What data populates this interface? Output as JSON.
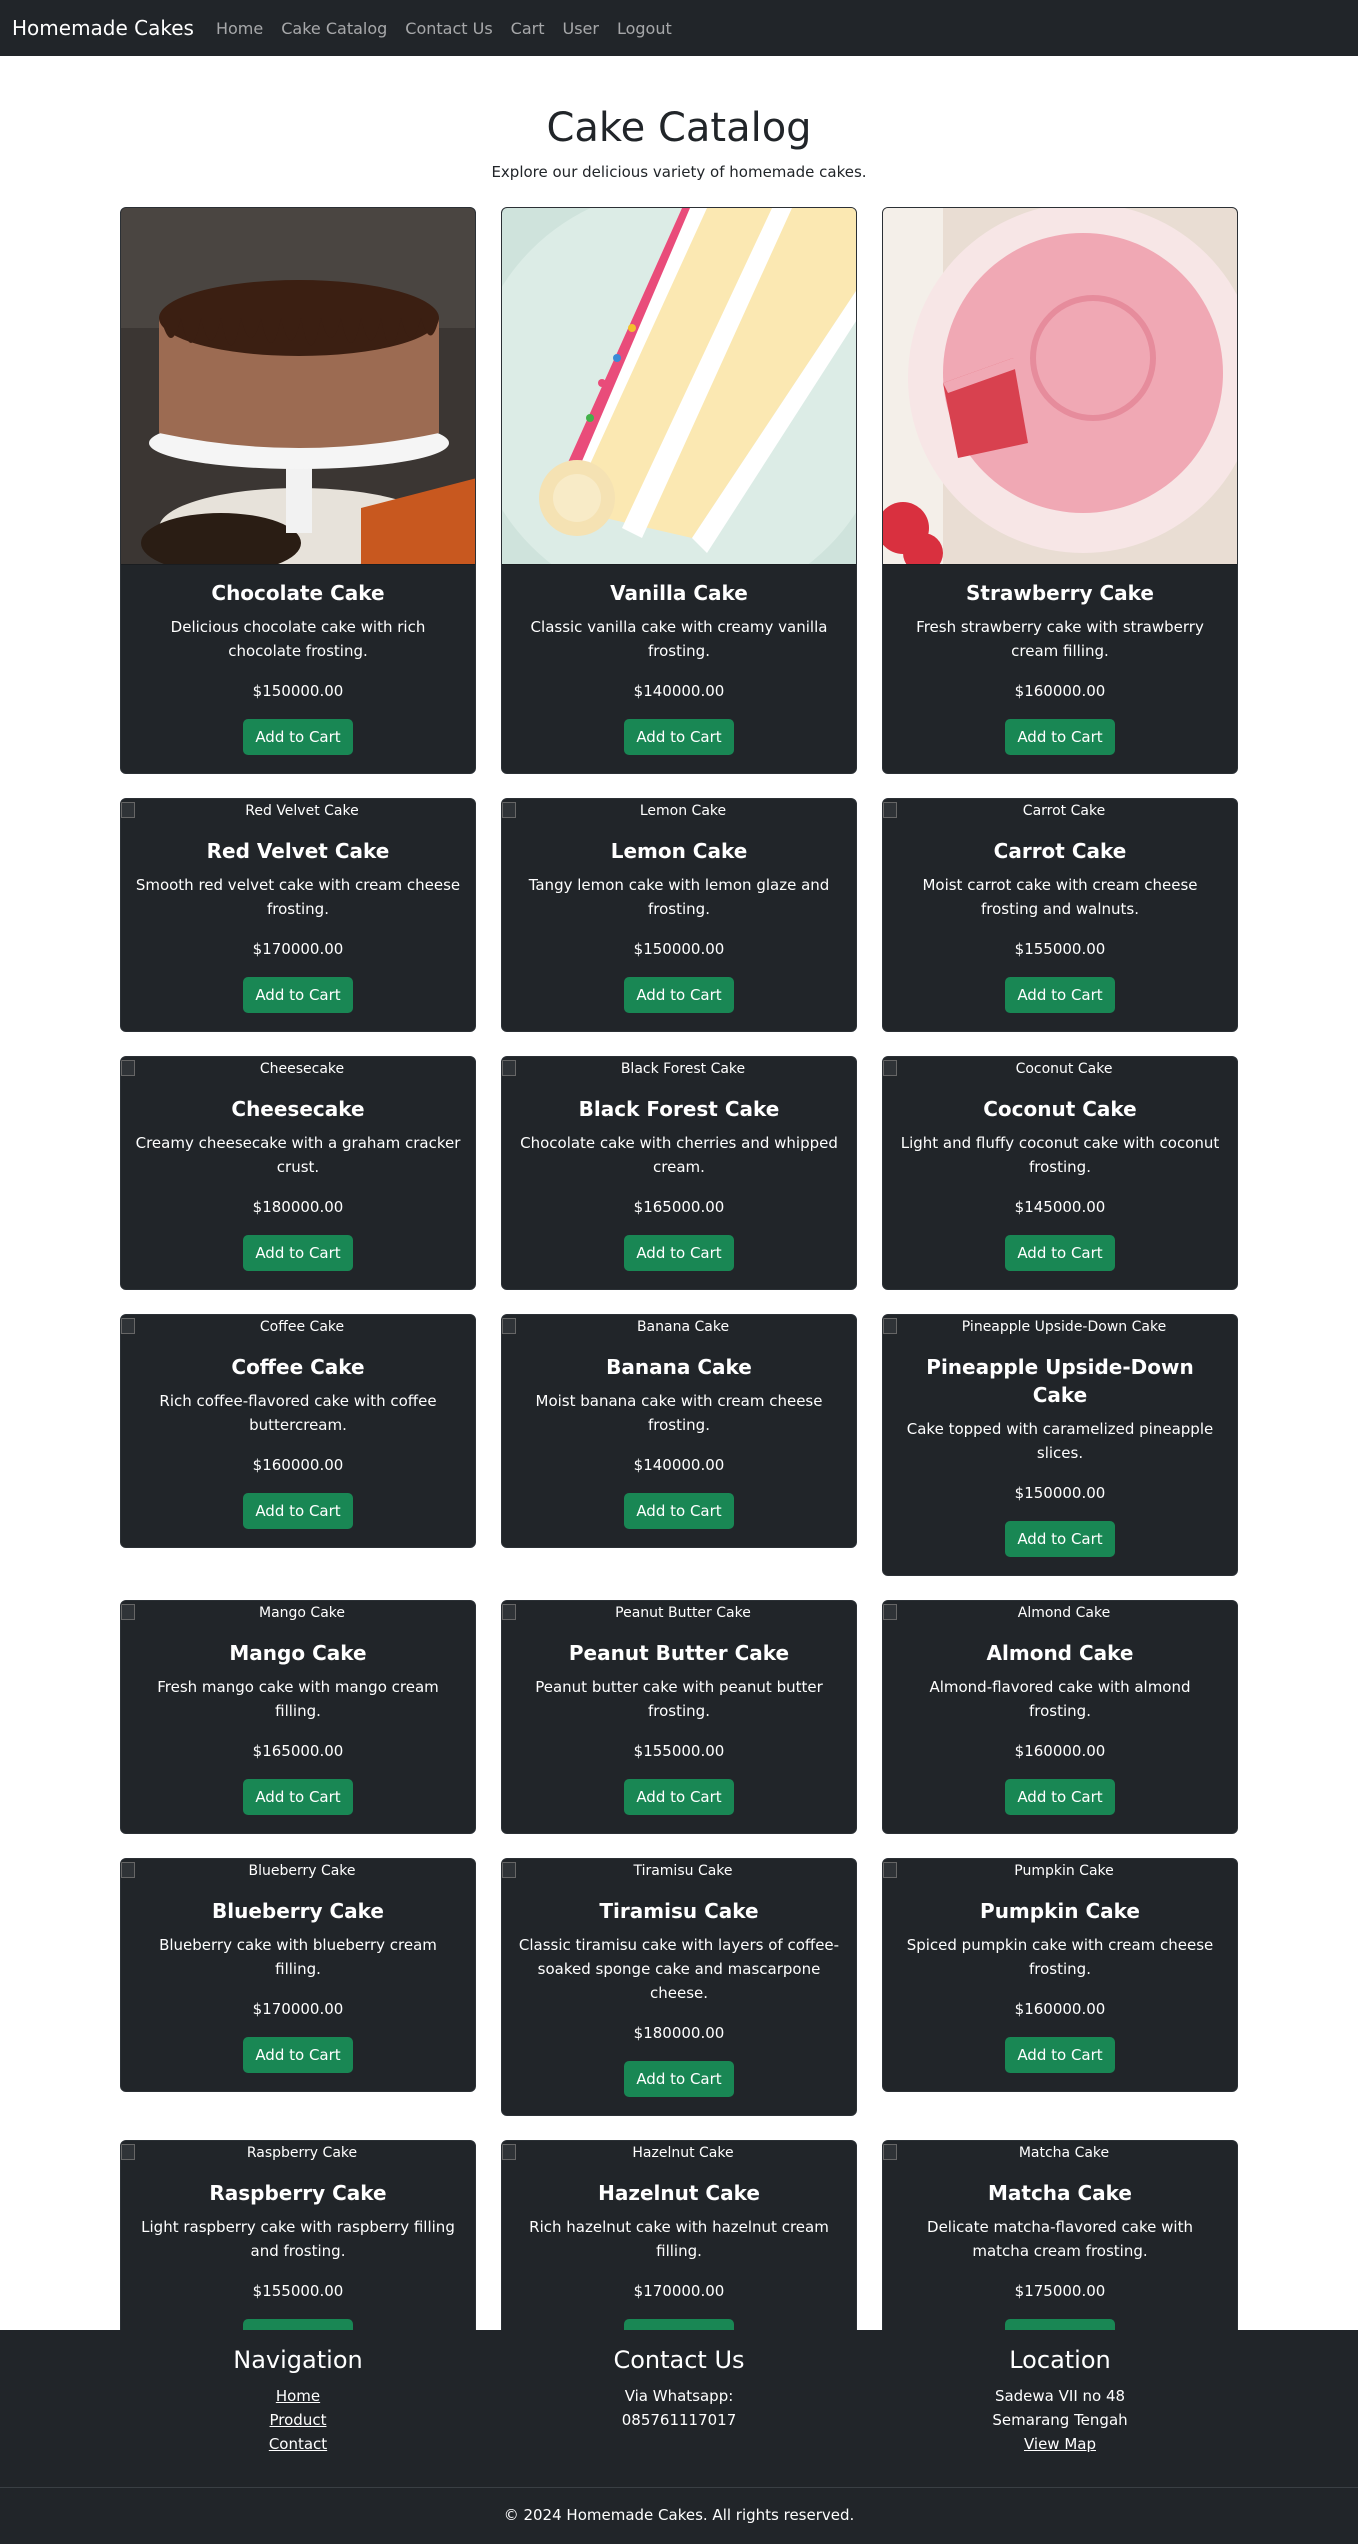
{
  "navbar": {
    "brand": "Homemade Cakes",
    "links": [
      "Home",
      "Cake Catalog",
      "Contact Us",
      "Cart",
      "User",
      "Logout"
    ]
  },
  "header": {
    "title": "Cake Catalog",
    "subtitle": "Explore our delicious variety of homemade cakes."
  },
  "cart_button_label": "Add to Cart",
  "cakes": [
    {
      "name": "Chocolate Cake",
      "description": "Delicious chocolate cake with rich chocolate frosting.",
      "price": "$150000.00",
      "image": "chocolate-cake-photo"
    },
    {
      "name": "Vanilla Cake",
      "description": "Classic vanilla cake with creamy vanilla frosting.",
      "price": "$140000.00",
      "image": "vanilla-cake-photo"
    },
    {
      "name": "Strawberry Cake",
      "description": "Fresh strawberry cake with strawberry cream filling.",
      "price": "$160000.00",
      "image": "strawberry-cake-photo"
    },
    {
      "name": "Red Velvet Cake",
      "alt": "Red Velvet Cake",
      "description": "Smooth red velvet cake with cream cheese frosting.",
      "price": "$170000.00"
    },
    {
      "name": "Lemon Cake",
      "alt": "Lemon Cake",
      "description": "Tangy lemon cake with lemon glaze and frosting.",
      "price": "$150000.00"
    },
    {
      "name": "Carrot Cake",
      "alt": "Carrot Cake",
      "description": "Moist carrot cake with cream cheese frosting and walnuts.",
      "price": "$155000.00"
    },
    {
      "name": "Cheesecake",
      "alt": "Cheesecake",
      "description": "Creamy cheesecake with a graham cracker crust.",
      "price": "$180000.00"
    },
    {
      "name": "Black Forest Cake",
      "alt": "Black Forest Cake",
      "description": "Chocolate cake with cherries and whipped cream.",
      "price": "$165000.00"
    },
    {
      "name": "Coconut Cake",
      "alt": "Coconut Cake",
      "description": "Light and fluffy coconut cake with coconut frosting.",
      "price": "$145000.00"
    },
    {
      "name": "Coffee Cake",
      "alt": "Coffee Cake",
      "description": "Rich coffee-flavored cake with coffee buttercream.",
      "price": "$160000.00"
    },
    {
      "name": "Banana Cake",
      "alt": "Banana Cake",
      "description": "Moist banana cake with cream cheese frosting.",
      "price": "$140000.00"
    },
    {
      "name": "Pineapple Upside-Down Cake",
      "alt": "Pineapple Upside-Down Cake",
      "description": "Cake topped with caramelized pineapple slices.",
      "price": "$150000.00"
    },
    {
      "name": "Mango Cake",
      "alt": "Mango Cake",
      "description": "Fresh mango cake with mango cream filling.",
      "price": "$165000.00"
    },
    {
      "name": "Peanut Butter Cake",
      "alt": "Peanut Butter Cake",
      "description": "Peanut butter cake with peanut butter frosting.",
      "price": "$155000.00"
    },
    {
      "name": "Almond Cake",
      "alt": "Almond Cake",
      "description": "Almond-flavored cake with almond frosting.",
      "price": "$160000.00"
    },
    {
      "name": "Blueberry Cake",
      "alt": "Blueberry Cake",
      "description": "Blueberry cake with blueberry cream filling.",
      "price": "$170000.00"
    },
    {
      "name": "Tiramisu Cake",
      "alt": "Tiramisu Cake",
      "description": "Classic tiramisu cake with layers of coffee-soaked sponge cake and mascarpone cheese.",
      "price": "$180000.00"
    },
    {
      "name": "Pumpkin Cake",
      "alt": "Pumpkin Cake",
      "description": "Spiced pumpkin cake with cream cheese frosting.",
      "price": "$160000.00"
    },
    {
      "name": "Raspberry Cake",
      "alt": "Raspberry Cake",
      "description": "Light raspberry cake with raspberry filling and frosting.",
      "price": "$155000.00"
    },
    {
      "name": "Hazelnut Cake",
      "alt": "Hazelnut Cake",
      "description": "Rich hazelnut cake with hazelnut cream filling.",
      "price": "$170000.00"
    },
    {
      "name": "Matcha Cake",
      "alt": "Matcha Cake",
      "description": "Delicate matcha-flavored cake with matcha cream frosting.",
      "price": "$175000.00"
    }
  ],
  "footer": {
    "navigation": {
      "title": "Navigation",
      "links": [
        "Home",
        "Product",
        "Contact"
      ]
    },
    "contact": {
      "title": "Contact Us",
      "lines": [
        "Via Whatsapp:",
        "085761117017"
      ]
    },
    "location": {
      "title": "Location",
      "lines": [
        "Sadewa VII no 48",
        "Semarang Tengah"
      ],
      "map_link": "View Map"
    },
    "copyright": "© 2024 Homemade Cakes. All rights reserved."
  },
  "colors": {
    "dark": "#212529",
    "button_green": "#198754",
    "page_bg": "#ffffff"
  }
}
